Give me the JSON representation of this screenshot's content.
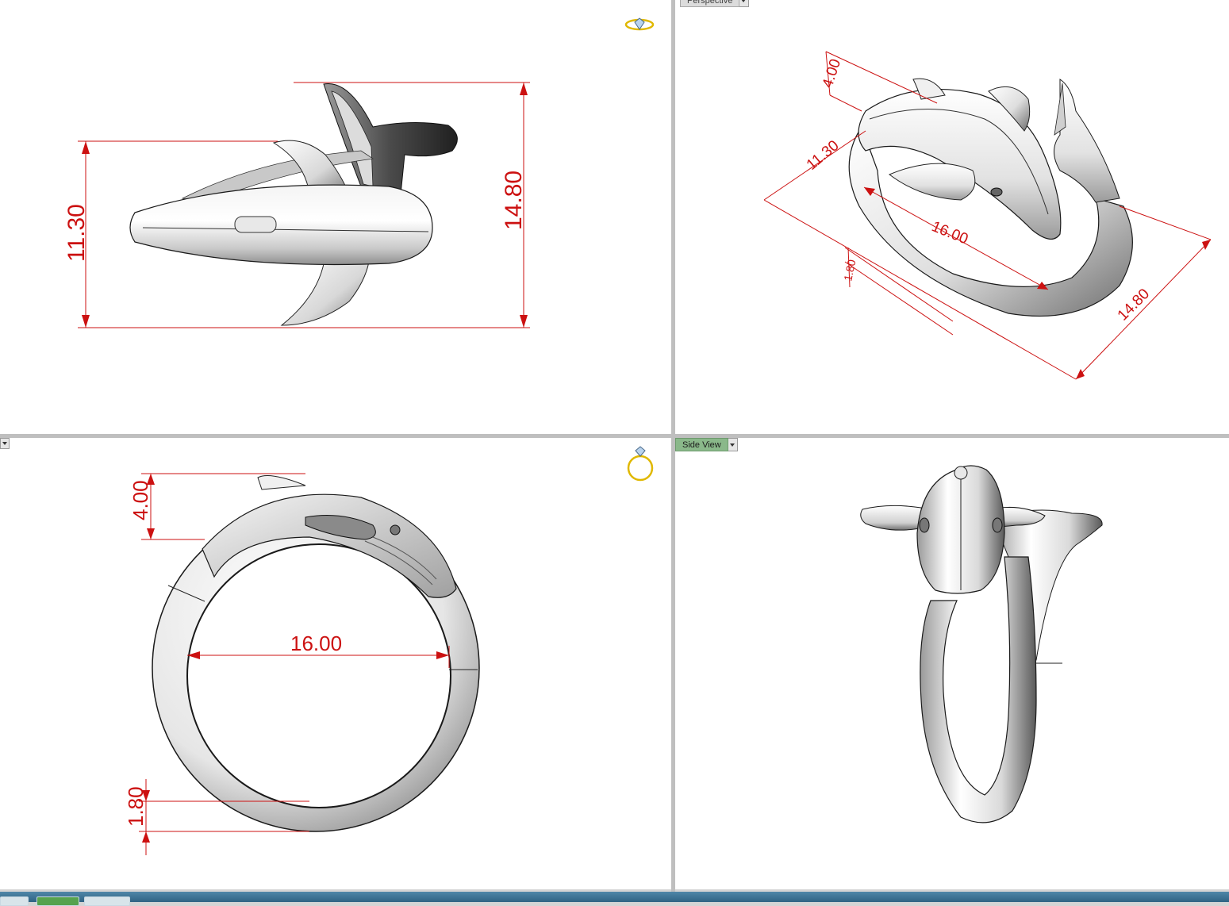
{
  "viewports": {
    "top": {
      "dims": {
        "width": "11.30",
        "length": "14.80"
      }
    },
    "perspective": {
      "label": "Perspective",
      "dims": {
        "top": "4.00",
        "width": "11.30",
        "inner": "16.00",
        "band": "1.80",
        "length": "14.80"
      }
    },
    "front": {
      "dims": {
        "height": "4.00",
        "inner": "16.00",
        "band": "1.80"
      }
    },
    "side": {
      "label": "Side View"
    }
  },
  "colors": {
    "dimension": "#cc1111",
    "tab_active": "#8ab88a",
    "ring_icon": "#e0b800",
    "taskbar": "#3c7396"
  },
  "icons": [
    "ring-diamond-icon",
    "ring-front-icon",
    "dropdown-arrow-icon"
  ]
}
